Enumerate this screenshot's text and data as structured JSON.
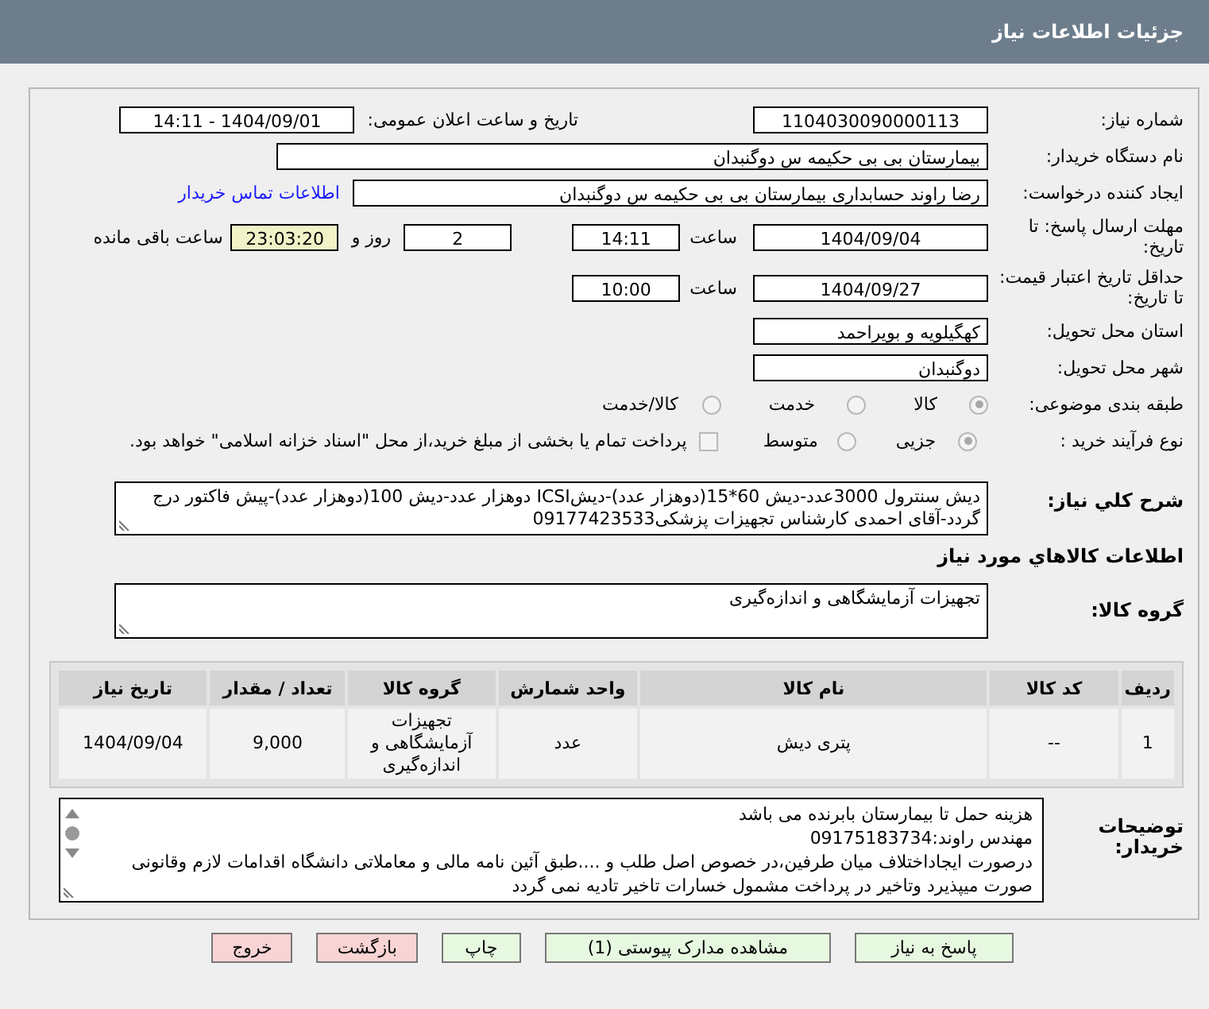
{
  "header": {
    "title": "جزئیات اطلاعات نیاز"
  },
  "need_number": {
    "label": "شماره نیاز:",
    "value": "1104030090000113"
  },
  "announce": {
    "label": "تاریخ و ساعت اعلان عمومی:",
    "value": "1404/09/01 - 14:11"
  },
  "buyer": {
    "label": "نام دستگاه خریدار:",
    "value": "بیمارستان بی بی حکیمه س  دوگنبدان"
  },
  "requester": {
    "label": "ایجاد کننده درخواست:",
    "value": "رضا راوند حسابداری بیمارستان بی بی حکیمه س  دوگنبدان",
    "link": "اطلاعات تماس خریدار"
  },
  "deadline": {
    "label": "مهلت ارسال پاسخ: تا تاریخ:",
    "date": "1404/09/04",
    "time_label": "ساعت",
    "time": "14:11",
    "days": "2",
    "days_label": "روز و",
    "remaining": "23:03:20",
    "remaining_label": "ساعت باقی مانده"
  },
  "validity": {
    "label": "حداقل تاریخ اعتبار قیمت: تا تاریخ:",
    "date": "1404/09/27",
    "time_label": "ساعت",
    "time": "10:00"
  },
  "province": {
    "label": "استان محل تحویل:",
    "value": "کهگیلویه و بویراحمد"
  },
  "city": {
    "label": "شهر محل تحویل:",
    "value": "دوگنبدان"
  },
  "category": {
    "label": "طبقه بندی موضوعی:",
    "options": [
      {
        "label": "کالا",
        "selected": true
      },
      {
        "label": "خدمت",
        "selected": false
      },
      {
        "label": "کالا/خدمت",
        "selected": false
      }
    ]
  },
  "process": {
    "label": "نوع فرآیند خرید :",
    "options": [
      {
        "label": "جزیی",
        "selected": true
      },
      {
        "label": "متوسط",
        "selected": false
      }
    ],
    "treasury": {
      "label": "پرداخت تمام یا بخشی از مبلغ خرید،از محل \"اسناد خزانه اسلامی\" خواهد بود.",
      "checked": false
    }
  },
  "description": {
    "label": "شرح کلي نیاز:",
    "value": "دیش سنترول 3000عدد-دیش 60*15(دوهزار عدد)-دیشICSI دوهزار عدد-دیش 100(دوهزار عدد)-پیش فاکتور درج گردد-آقای احمدی کارشناس تجهیزات پزشکی09177423533"
  },
  "goods_heading": "اطلاعات کالاهاي مورد نیاز",
  "goods_group": {
    "label": "گروه کالا:",
    "value": "تجهیزات آزمایشگاهی و اندازه‌گیری"
  },
  "table": {
    "columns": [
      "ردیف",
      "کد کالا",
      "نام کالا",
      "واحد شمارش",
      "گروه کالا",
      "تعداد / مقدار",
      "تاریخ نیاز"
    ],
    "rows": [
      [
        "1",
        "--",
        "پتری دیش",
        "عدد",
        "تجهیزات آزمایشگاهی و اندازه‌گیری",
        "9,000",
        "1404/09/04"
      ]
    ]
  },
  "notes": {
    "label": "توضیحات خریدار:",
    "lines": [
      "هزینه حمل تا بیمارستان بابرنده می باشد",
      "مهندس راوند:09175183734",
      "درصورت ایجاداختلاف میان طرفین،در خصوص اصل طلب و ....طبق آئین نامه مالی و معاملاتی دانشگاه اقدامات لازم وقانونی",
      "صورت میپذیرد وتاخیر در پرداخت مشمول خسارات تاخیر تادیه نمی گردد"
    ]
  },
  "buttons": [
    {
      "label": "پاسخ به نیاز",
      "kind": "action"
    },
    {
      "label": "مشاهده مدارک پیوستی (1)",
      "kind": "action"
    },
    {
      "label": "چاپ",
      "kind": "action"
    },
    {
      "label": "بازگشت",
      "kind": "exit"
    },
    {
      "label": "خروج",
      "kind": "exit"
    }
  ]
}
